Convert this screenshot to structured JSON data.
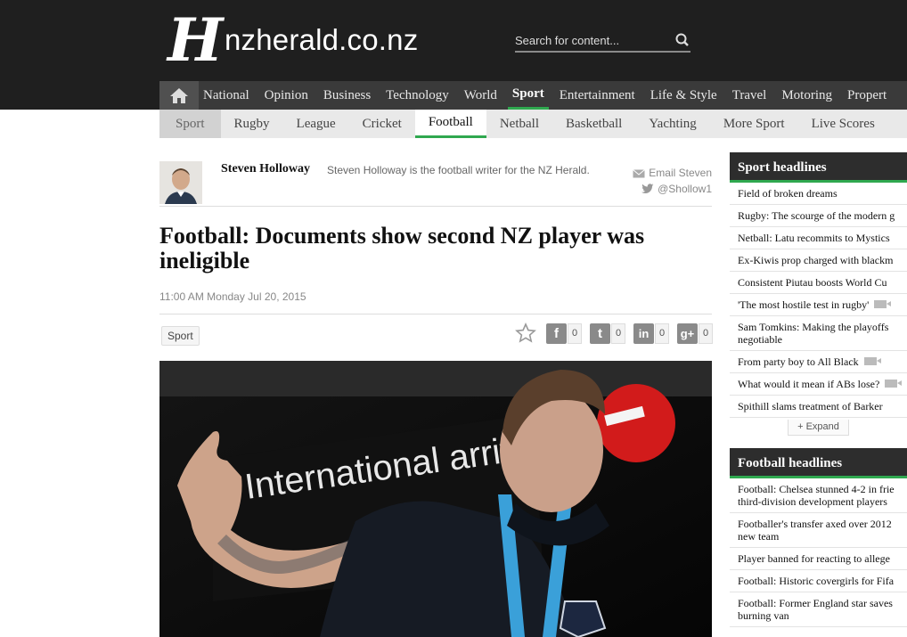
{
  "header": {
    "logo_letter": "H",
    "site_name": "nzherald.co.nz",
    "search_placeholder": "Search for content..."
  },
  "main_nav": {
    "items": [
      "National",
      "Opinion",
      "Business",
      "Technology",
      "World",
      "Sport",
      "Entertainment",
      "Life & Style",
      "Travel",
      "Motoring",
      "Propert"
    ],
    "active": "Sport"
  },
  "sub_nav": {
    "items": [
      "Sport",
      "Rugby",
      "League",
      "Cricket",
      "Football",
      "Netball",
      "Basketball",
      "Yachting",
      "More Sport",
      "Live Scores"
    ],
    "active": "Football"
  },
  "author": {
    "name": "Steven Holloway",
    "bio": "Steven Holloway is the football writer for the NZ Herald.",
    "email_label": "Email Steven",
    "twitter_handle": "@Shollow1"
  },
  "article": {
    "headline": "Football: Documents show second NZ player was ineligible",
    "date": "11:00 AM Monday Jul 20, 2015",
    "tag": "Sport",
    "image_sign_text": "International arrivals"
  },
  "social": {
    "facebook": {
      "icon": "f",
      "count": "0"
    },
    "twitter": {
      "icon": "t",
      "count": "0"
    },
    "linkedin": {
      "icon": "in",
      "count": "0"
    },
    "googleplus": {
      "icon": "g+",
      "count": "0"
    }
  },
  "sport_headlines": {
    "title": "Sport headlines",
    "items": [
      "Field of broken dreams",
      "Rugby: The scourge of the modern g",
      "Netball: Latu recommits to Mystics",
      "Ex-Kiwis prop charged with blackm",
      "Consistent Piutau boosts World Cu",
      "'The most hostile test in rugby'",
      "Sam Tomkins: Making the playoffs negotiable",
      "From party boy to All Black",
      "What would it mean if ABs lose?",
      "Spithill slams treatment of Barker"
    ],
    "expand_label": "+ Expand"
  },
  "football_headlines": {
    "title": "Football headlines",
    "items": [
      "Football: Chelsea stunned 4-2 in frie third-division development players",
      "Footballer's transfer axed over 2012 new team",
      "Player banned for reacting to allege",
      "Football: Historic covergirls for Fifa",
      "Football: Former England star saves burning van"
    ]
  },
  "colors": {
    "header_bg": "#1f1f1f",
    "accent_green": "#2fa84f",
    "nav_bg": "#3a3a3a",
    "subnav_bg": "#e9e9e9"
  }
}
